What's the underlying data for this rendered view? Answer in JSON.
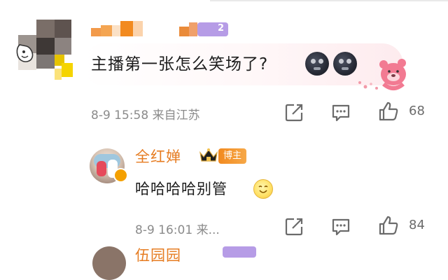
{
  "comment1": {
    "text": "主播第一张怎么笑场了?",
    "emojis": [
      "new-moon-face-emoji",
      "new-moon-face-emoji"
    ],
    "sticker": "strawberry-bear-sticker",
    "meta": "8-9 15:58 来自江苏",
    "likes": "68",
    "user_level_badge": "2"
  },
  "reply": {
    "username": "全红婵",
    "role_badge": "博主",
    "text": "哈哈哈哈别管",
    "emoji": "smile-emoji",
    "meta": "8-9 16:01 来...",
    "likes": "84"
  },
  "next_comment": {
    "username": "伍园园"
  },
  "colors": {
    "username_orange": "#e67c21",
    "meta_gray": "#8b8b8b",
    "badge_orange": "#f28a1f",
    "level_badge_purple": "#b69ce6"
  },
  "icons": [
    "share-icon",
    "comment-icon",
    "thumbs-up-icon"
  ]
}
